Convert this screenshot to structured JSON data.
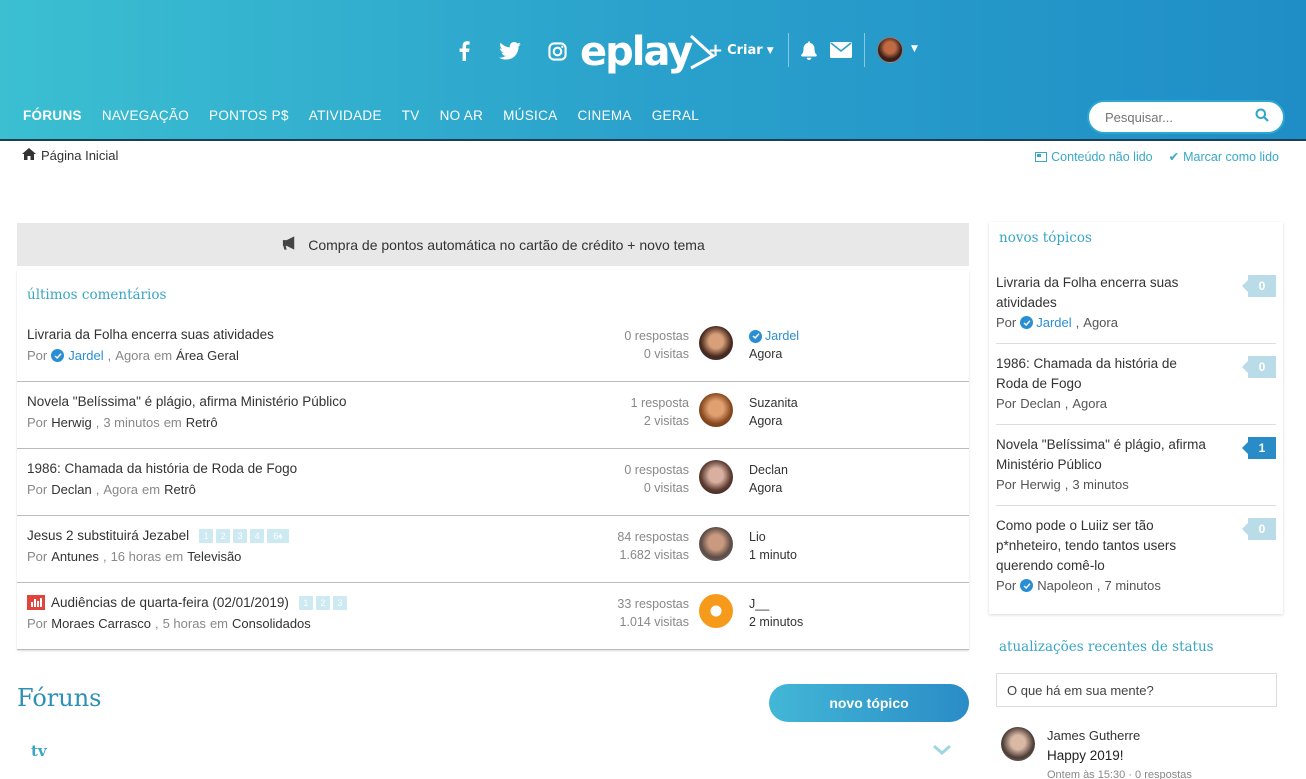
{
  "header": {
    "logo": "eplay",
    "create_label": "Criar",
    "search_placeholder": "Pesquisar...",
    "nav": [
      "FÓRUNS",
      "NAVEGAÇÃO",
      "PONTOS P$",
      "ATIVIDADE",
      "TV",
      "NO AR",
      "MÚSICA",
      "CINEMA",
      "GERAL"
    ]
  },
  "breadcrumb": {
    "home": "Página Inicial"
  },
  "toplinks": {
    "unread": "Conteúdo não lido",
    "mark_read": "Marcar como lido"
  },
  "announcement": "Compra de pontos automática no cartão de crédito + novo tema",
  "latest_comments": {
    "title": "últimos comentários",
    "rows": [
      {
        "title": "Livraria da Folha encerra suas atividades",
        "by": "Por",
        "author": "Jardel",
        "author_verified": true,
        "time": "Agora",
        "in": "em",
        "forum": "Área Geral",
        "replies": "0 respostas",
        "views": "0 visitas",
        "last_user": "Jardel",
        "last_verified": true,
        "last_time": "Agora"
      },
      {
        "title": "Novela \"Belíssima\" é plágio, afirma Ministério Público",
        "by": "Por",
        "author": "Herwig",
        "time": "3 minutos",
        "in": "em",
        "forum": "Retrô",
        "replies": "1 resposta",
        "views": "2 visitas",
        "last_user": "Suzanita",
        "last_time": "Agora"
      },
      {
        "title": "1986: Chamada da história de Roda de Fogo",
        "by": "Por",
        "author": "Declan",
        "time": "Agora",
        "in": "em",
        "forum": "Retrô",
        "replies": "0 respostas",
        "views": "0 visitas",
        "last_user": "Declan",
        "last_time": "Agora"
      },
      {
        "title": "Jesus 2 substituirá Jezabel",
        "pages": [
          "1",
          "2",
          "3",
          "4",
          "6♦"
        ],
        "by": "Por",
        "author": "Antunes",
        "time": "16 horas",
        "in": "em",
        "forum": "Televisão",
        "replies": "84 respostas",
        "views": "1.682 visitas",
        "last_user": "Lio",
        "last_time": "1 minuto"
      },
      {
        "title": "Audiências de quarta-feira (02/01/2019)",
        "pages": [
          "1",
          "2",
          "3"
        ],
        "chart_icon": true,
        "by": "Por",
        "author": "Moraes Carrasco",
        "time": "5 horas",
        "in": "em",
        "forum": "Consolidados",
        "replies": "33 respostas",
        "views": "1.014 visitas",
        "last_user": "J__",
        "last_time": "2 minutos"
      }
    ]
  },
  "forums": {
    "title": "Fóruns",
    "new_topic": "novo tópico",
    "first_category": "tv"
  },
  "new_topics": {
    "title": "novos tópicos",
    "items": [
      {
        "title": "Livraria da Folha encerra suas atividades",
        "by": "Por",
        "author": "Jardel",
        "verified": true,
        "time": "Agora",
        "count": "0"
      },
      {
        "title": "1986: Chamada da história de Roda de Fogo",
        "by": "Por",
        "author": "Declan",
        "time": "Agora",
        "count": "0"
      },
      {
        "title": "Novela \"Belíssima\" é plágio, afirma Ministério Público",
        "by": "Por",
        "author": "Herwig",
        "time": "3 minutos",
        "count": "1"
      },
      {
        "title": "Como pode o Luiiz ser tão p*nheteiro, tendo tantos users querendo comê-lo",
        "by": "Por",
        "author": "Napoleon",
        "verified": true,
        "time": "7 minutos",
        "count": "0"
      }
    ]
  },
  "status_updates": {
    "title": "atualizações recentes de status",
    "placeholder": "O que há em sua mente?",
    "author": "James Gutherre",
    "message": "Happy 2019!",
    "meta": "Ontem às 15:30 · 0 respostas"
  }
}
